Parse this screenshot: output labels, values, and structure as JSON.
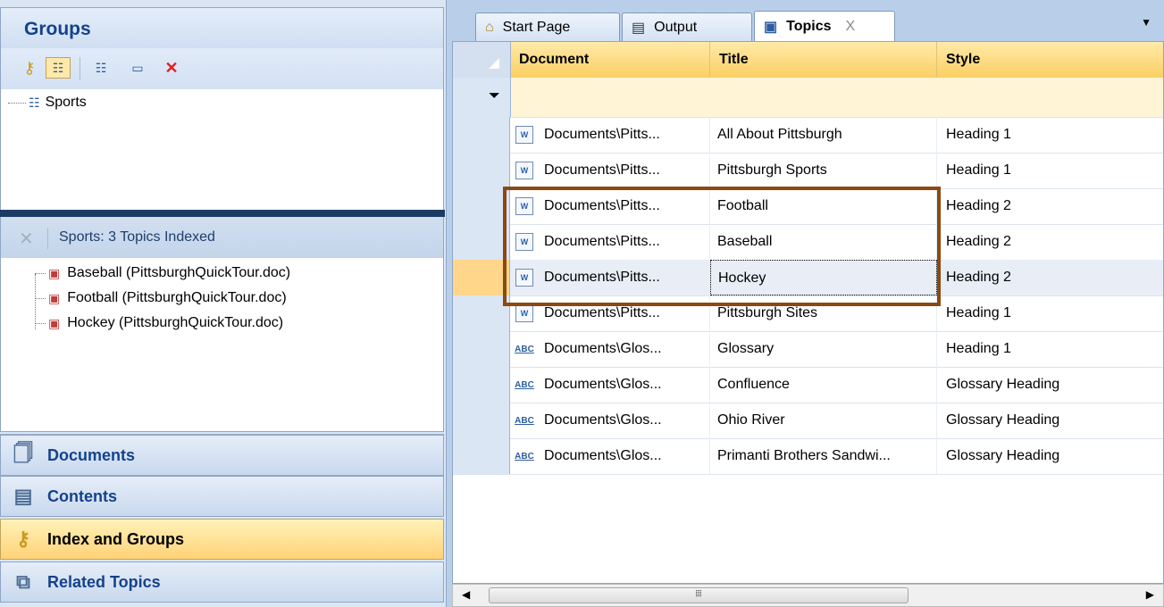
{
  "groups_panel": {
    "title": "Groups",
    "toolbar": [
      "key-icon",
      "group-tree-icon",
      "add-group-icon",
      "rename-icon",
      "delete-icon"
    ],
    "tree": [
      {
        "label": "Sports"
      }
    ]
  },
  "index_panel": {
    "header": "Sports: 3 Topics Indexed",
    "items": [
      {
        "label": "Baseball (PittsburghQuickTour.doc)"
      },
      {
        "label": "Football (PittsburghQuickTour.doc)"
      },
      {
        "label": "Hockey (PittsburghQuickTour.doc)"
      }
    ]
  },
  "nav": [
    {
      "label": "Documents",
      "icon": "documents-icon",
      "active": false
    },
    {
      "label": "Contents",
      "icon": "contents-icon",
      "active": false
    },
    {
      "label": "Index and Groups",
      "icon": "key-icon",
      "active": true
    },
    {
      "label": "Related Topics",
      "icon": "related-topics-icon",
      "active": false
    }
  ],
  "tabs": [
    {
      "label": "Start Page",
      "icon": "home-icon",
      "active": false
    },
    {
      "label": "Output",
      "icon": "output-icon",
      "active": false
    },
    {
      "label": "Topics",
      "icon": "topics-icon",
      "active": true,
      "close": "X"
    }
  ],
  "grid": {
    "columns": [
      "Document",
      "Title",
      "Style"
    ],
    "rows": [
      {
        "document": "Documents\\Pitts...",
        "title": "All About Pittsburgh",
        "style": "Heading 1",
        "icon": "word-doc-icon"
      },
      {
        "document": "Documents\\Pitts...",
        "title": "Pittsburgh Sports",
        "style": "Heading 1",
        "icon": "word-doc-icon"
      },
      {
        "document": "Documents\\Pitts...",
        "title": "Football",
        "style": "Heading 2",
        "icon": "word-doc-icon"
      },
      {
        "document": "Documents\\Pitts...",
        "title": "Baseball",
        "style": "Heading 2",
        "icon": "word-doc-icon"
      },
      {
        "document": "Documents\\Pitts...",
        "title": "Hockey",
        "style": "Heading 2",
        "icon": "word-doc-icon",
        "selected": true
      },
      {
        "document": "Documents\\Pitts...",
        "title": "Pittsburgh Sites",
        "style": "Heading 1",
        "icon": "word-doc-icon"
      },
      {
        "document": "Documents\\Glos...",
        "title": "Glossary",
        "style": "Heading 1",
        "icon": "glossary-icon"
      },
      {
        "document": "Documents\\Glos...",
        "title": "Confluence",
        "style": "Glossary Heading",
        "icon": "glossary-icon"
      },
      {
        "document": "Documents\\Glos...",
        "title": "Ohio River",
        "style": "Glossary Heading",
        "icon": "glossary-icon"
      },
      {
        "document": "Documents\\Glos...",
        "title": "Primanti Brothers Sandwi...",
        "style": "Glossary Heading",
        "icon": "glossary-icon"
      }
    ]
  },
  "colors": {
    "highlight_box": "#8a4a12",
    "header_gold": "#fbcf63",
    "nav_active": "#ffd277"
  }
}
